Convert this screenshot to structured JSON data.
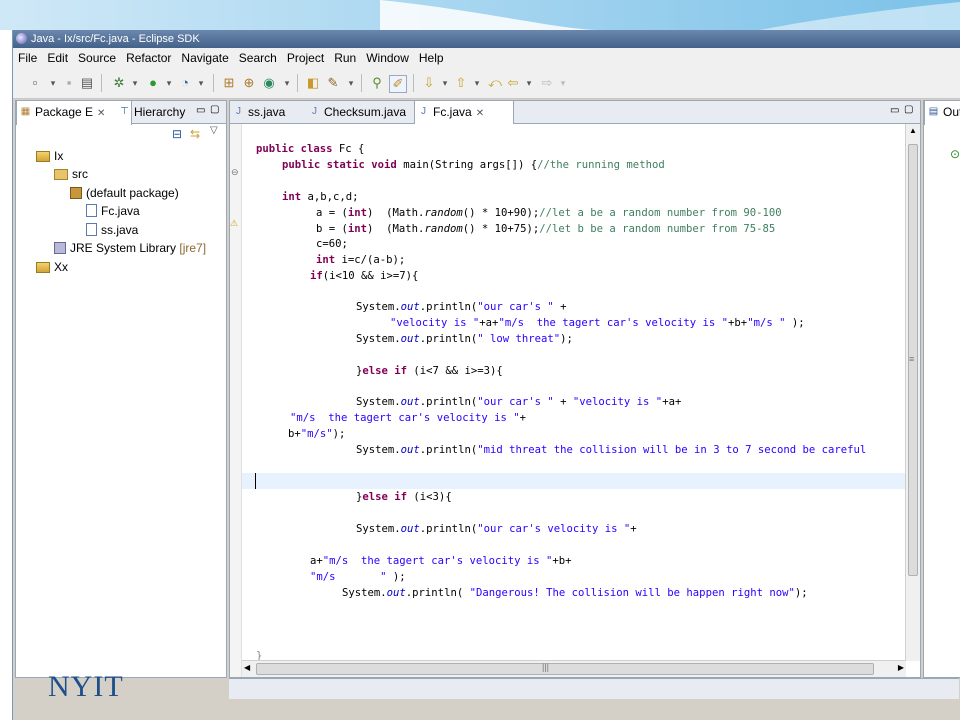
{
  "window": {
    "title": "Java - Ix/src/Fc.java - Eclipse SDK"
  },
  "menu": [
    "File",
    "Edit",
    "Source",
    "Refactor",
    "Navigate",
    "Search",
    "Project",
    "Run",
    "Window",
    "Help"
  ],
  "package_explorer": {
    "tabs": [
      {
        "label": "Package E"
      },
      {
        "label": "Hierarchy"
      }
    ],
    "tree": [
      {
        "label": "Ix",
        "icon": "project-icon"
      },
      {
        "label": "src",
        "icon": "source-folder-icon"
      },
      {
        "label": "(default package)",
        "icon": "package-icon"
      },
      {
        "label": "Fc.java",
        "icon": "java-file-icon"
      },
      {
        "label": "ss.java",
        "icon": "java-file-icon"
      },
      {
        "label": "JRE System Library",
        "tag": "[jre7]",
        "icon": "library-icon"
      },
      {
        "label": "Xx",
        "icon": "project-icon"
      }
    ]
  },
  "editor": {
    "tabs": [
      {
        "label": "ss.java"
      },
      {
        "label": "Checksum.java"
      },
      {
        "label": "Fc.java"
      }
    ],
    "active_tab": "Fc.java"
  },
  "outline": {
    "tab_label": "Out"
  },
  "branding": {
    "logo_text": "NYIT"
  },
  "colors": {
    "keyword": "#7f0055",
    "comment": "#3f7f5f",
    "string": "#2a00ff",
    "field": "#0000c0"
  }
}
